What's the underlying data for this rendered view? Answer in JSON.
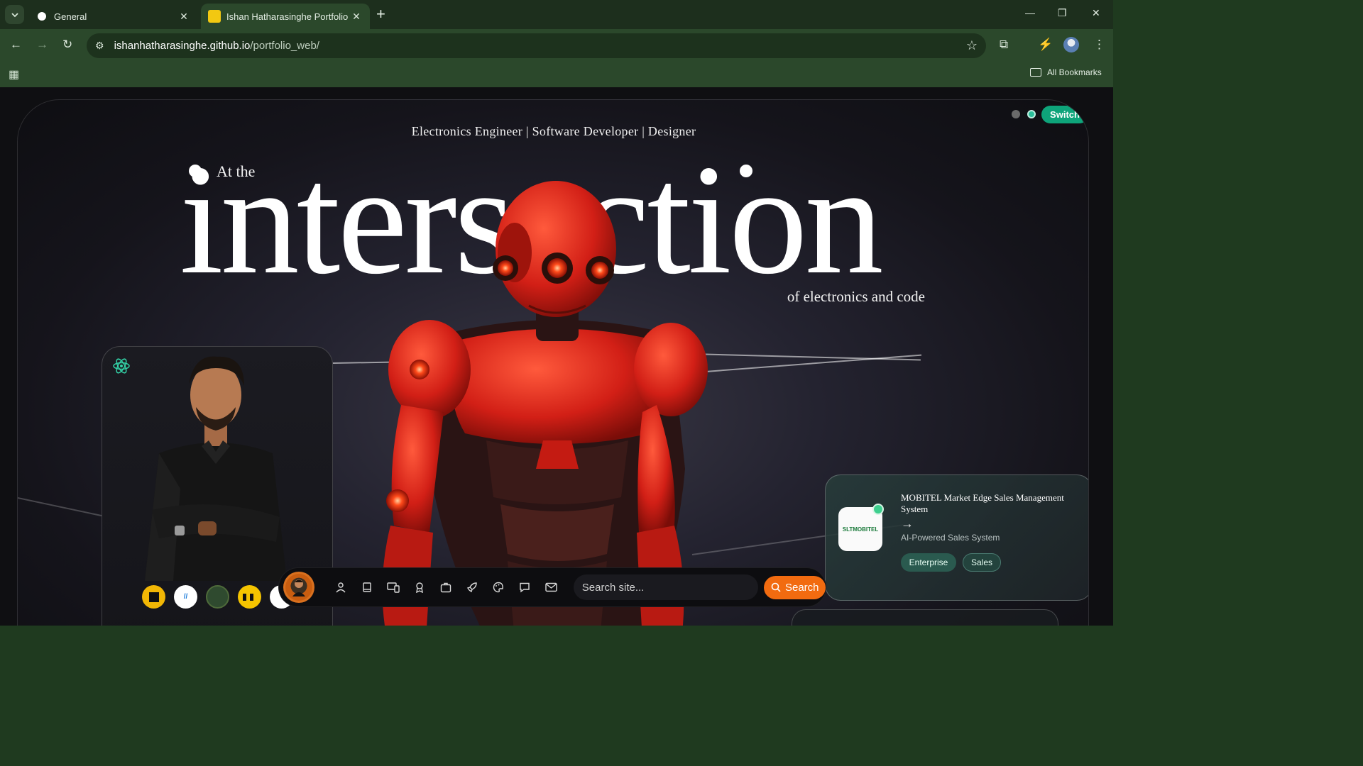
{
  "browser": {
    "tabs": [
      {
        "title": "General",
        "icon": "github-icon"
      },
      {
        "title": "Ishan Hatharasinghe Portfolio",
        "icon": "portfolio-favicon"
      }
    ],
    "address": {
      "host": "ishanhatharasinghe.github.io",
      "path": "/portfolio_web/"
    },
    "bookmarks_label": "All Bookmarks"
  },
  "hero": {
    "tagline": "Electronics Engineer | Software Developer | Designer",
    "switch_label": "Switch",
    "lead": "At the",
    "big_word": "intersection",
    "subline": "of electronics and code"
  },
  "dock": {
    "search_placeholder": "Search site...",
    "search_button": "Search",
    "icons": [
      "user-icon",
      "book-icon",
      "devices-icon",
      "award-icon",
      "briefcase-icon",
      "rocket-icon",
      "palette-icon",
      "chat-icon",
      "mail-icon"
    ]
  },
  "project": {
    "title": "MOBITEL Market Edge Sales Management System",
    "subtitle": "AI-Powered Sales System",
    "tags": [
      "Enterprise",
      "Sales"
    ],
    "logo_text": "SLTMOBITEL"
  },
  "colors": {
    "accent_green": "#0ea47a",
    "accent_orange": "#f26b10",
    "chrome_green": "#2b482b"
  }
}
